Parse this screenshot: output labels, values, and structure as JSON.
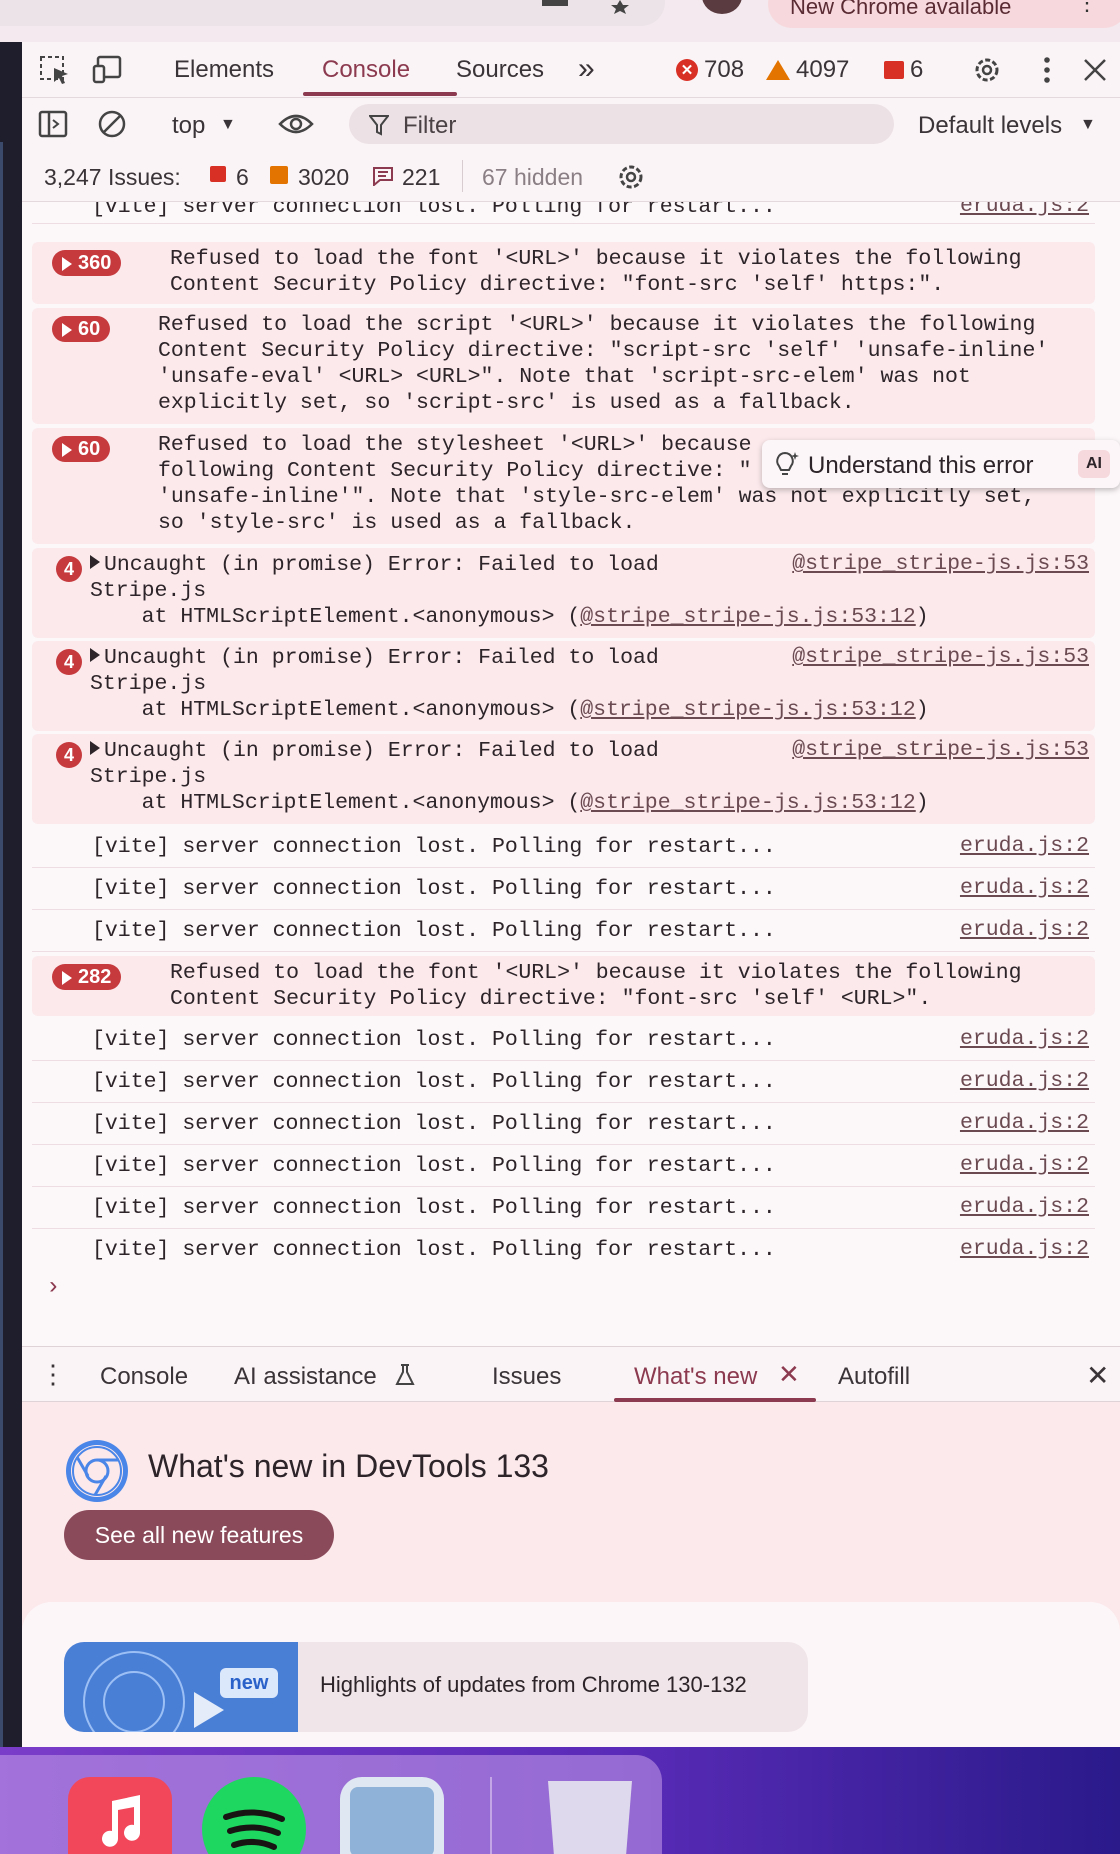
{
  "browser": {
    "update_pill": "New Chrome available"
  },
  "devtools": {
    "tabs": [
      "Elements",
      "Console",
      "Sources"
    ],
    "more_tabs": "»",
    "counters": {
      "errors": "708",
      "warnings": "4097",
      "issues": "6"
    }
  },
  "toolbar": {
    "context": "top",
    "filter_placeholder": "Filter",
    "levels": "Default levels"
  },
  "issues_bar": {
    "label": "3,247 Issues:",
    "errors": "6",
    "warnings": "3020",
    "info": "221",
    "hidden": "67 hidden"
  },
  "log": {
    "vite": "[vite] server connection lost. Polling for restart...",
    "eruda": "eruda.js:2",
    "font1_count": "360",
    "font1_l1": "Refused to load the font '<URL>' because it violates the following",
    "font1_l2": "Content Security Policy directive: \"font-src 'self' https:\".",
    "script_count": "60",
    "script_l1": "Refused to load the script '<URL>' because it violates the following",
    "script_l2": "Content Security Policy directive: \"script-src 'self' 'unsafe-inline'",
    "script_l3": "'unsafe-eval' <URL> <URL>\". Note that 'script-src-elem' was not",
    "script_l4": "explicitly set, so 'script-src' is used as a fallback.",
    "style_count": "60",
    "style_l1": "Refused to load the stylesheet '<URL>' because",
    "style_l2": "following Content Security Policy directive: \"",
    "style_l3": "'unsafe-inline'\". Note that 'style-src-elem' was not explicitly set,",
    "style_l4": "so 'style-src' is used as a fallback.",
    "stripe_count": "4",
    "stripe_l1": "Uncaught (in promise) Error: Failed to load",
    "stripe_l2": "Stripe.js",
    "stripe_l3_prefix": "    at HTMLScriptElement.<anonymous> (",
    "stripe_l3_link": "@stripe_stripe-js.js:53:12",
    "stripe_l3_suffix": ")",
    "stripe_src": "@stripe_stripe-js.js:53",
    "font2_count": "282",
    "font2_l1": "Refused to load the font '<URL>' because it violates the following",
    "font2_l2": "Content Security Policy directive: \"font-src 'self' <URL>\".",
    "prompt": "›"
  },
  "tooltip": {
    "label": "Understand this error",
    "ai": "AI"
  },
  "drawer": {
    "tabs": [
      "Console",
      "AI assistance",
      "Issues",
      "What's new",
      "Autofill"
    ],
    "title": "What's new in DevTools 133",
    "button": "See all new features",
    "new_tag": "new",
    "highlight": "Highlights of updates from Chrome 130-132"
  },
  "colors": {
    "accent": "#8b3a4f",
    "error": "#c6393d",
    "warning": "#e37400"
  }
}
